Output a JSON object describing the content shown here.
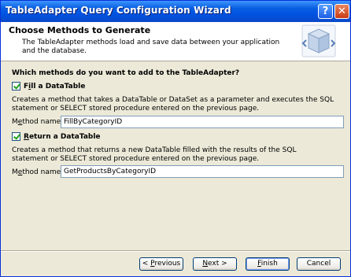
{
  "window": {
    "title": "TableAdapter Query Configuration Wizard",
    "help_glyph": "?",
    "close_glyph": "✕"
  },
  "header": {
    "title": "Choose Methods to Generate",
    "description": "The TableAdapter methods load and save data between your application and the database."
  },
  "main": {
    "question": "Which methods do you want to add to the TableAdapter?",
    "fill": {
      "checked": true,
      "label_prefix": "F",
      "label_mnemonic": "i",
      "label_rest": "ll a DataTable",
      "description": "Creates a method that takes a DataTable or DataSet as a parameter and executes the SQL statement or SELECT stored procedure entered on the previous page.",
      "method_label_prefix": "M",
      "method_label_mnemonic": "e",
      "method_label_rest": "thod name:",
      "method_value": "FillByCategoryID"
    },
    "return": {
      "checked": true,
      "label_prefix": "",
      "label_mnemonic": "R",
      "label_rest": "eturn a DataTable",
      "description": "Creates a method that returns a new DataTable filled with the results of the SQL statement or SELECT stored procedure entered on the previous page.",
      "method_label_prefix": "M",
      "method_label_mnemonic": "e",
      "method_label_rest": "thod name:",
      "method_value": "GetProductsByCategoryID"
    }
  },
  "footer": {
    "previous": {
      "prefix": "< ",
      "mnemonic": "P",
      "rest": "revious"
    },
    "next": {
      "prefix": "",
      "mnemonic": "N",
      "rest": "ext >"
    },
    "finish": {
      "prefix": "",
      "mnemonic": "F",
      "rest": "inish"
    },
    "cancel": {
      "label": "Cancel"
    }
  }
}
